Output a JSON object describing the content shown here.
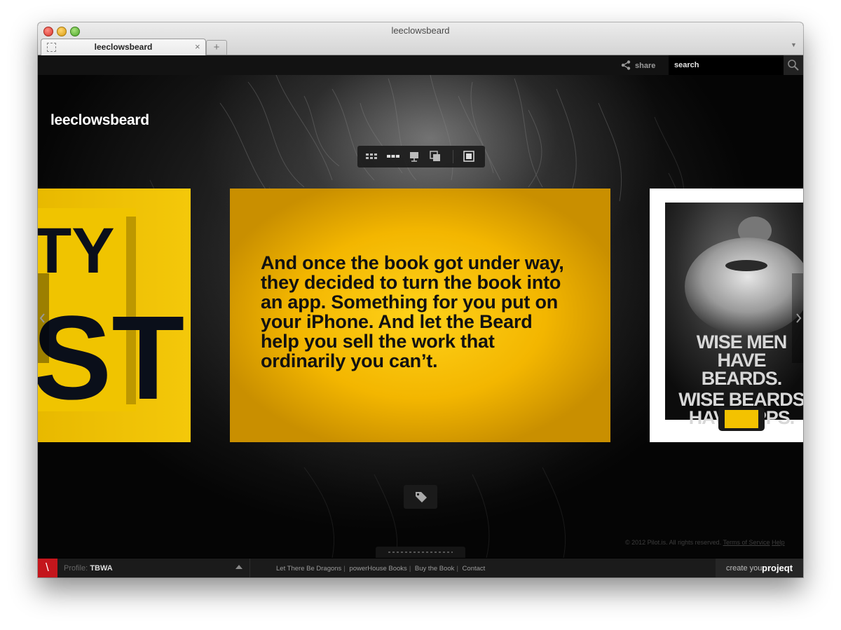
{
  "window": {
    "title": "leeclowsbeard",
    "tab_label": "leeclowsbeard",
    "tab_close": "×",
    "new_tab": "+"
  },
  "topbar": {
    "share_label": "share",
    "search_placeholder": "search",
    "search_value": ""
  },
  "site": {
    "title": "leeclowsbeard"
  },
  "viewbar": {
    "icons": [
      "grid-view-icon",
      "strip-view-icon",
      "presentation-view-icon",
      "stack-view-icon",
      "fullscreen-icon"
    ]
  },
  "slides": {
    "left": {
      "text": "TY ST"
    },
    "main": {
      "text": "And once the book got under way, they decided to turn the book into an app. Something for you put on your iPhone. And let the Beard help you sell the work that ordinarily you can’t."
    },
    "right": {
      "line1": "WISE MEN",
      "line2": "HAVE BEARDS.",
      "line3": "WISE BEARDS",
      "line4": "HAVE APPS."
    }
  },
  "copyright": {
    "text": "© 2012 Pilot.is. All rights reserved.",
    "terms": "Terms of Service",
    "help": "Help"
  },
  "footer": {
    "logo": "\\",
    "profile_label": "Profile:",
    "profile_name": "TBWA",
    "links": [
      "Let There Be Dragons",
      "powerHouse Books",
      "Buy the Book",
      "Contact"
    ],
    "create_label": "create your",
    "create_brand": "projeqt"
  },
  "colors": {
    "accent_yellow": "#f3b600",
    "logo_red": "#c4161c",
    "background": "#000000"
  }
}
